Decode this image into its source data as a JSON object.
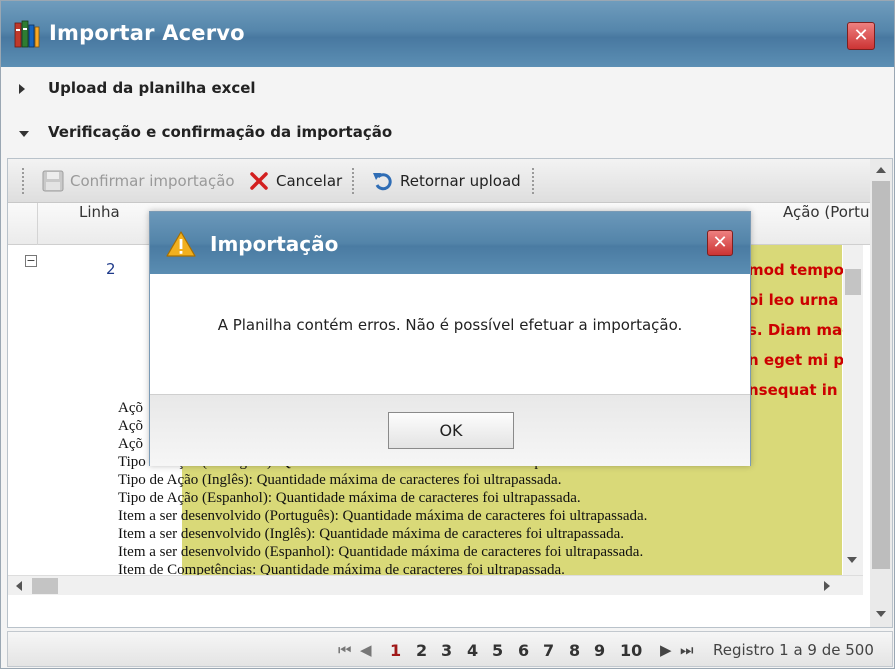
{
  "window": {
    "title": "Importar Acervo"
  },
  "accordion": [
    {
      "label": "Upload da planilha excel",
      "expanded": false
    },
    {
      "label": "Verificação e confirmação da importação",
      "expanded": true
    }
  ],
  "toolbar": {
    "confirm_label": "Confirmar importação",
    "cancel_label": "Cancelar",
    "return_label": "Retornar upload"
  },
  "grid": {
    "columns": {
      "linha": "Linha",
      "acao": "Ação (Portu"
    },
    "row": {
      "number": "2",
      "red_texts": [
        "mod tempo",
        "oi leo urna",
        "s. Diam mad",
        "n eget mi p",
        "nsequat in"
      ],
      "errors": [
        "Açõ",
        "Açõ",
        "Açõ",
        "Tipo de Ação (Português): Quantidade máxima de caracteres foi ultrapassada.",
        "Tipo de Ação (Inglês): Quantidade máxima de caracteres foi ultrapassada.",
        "Tipo de Ação (Espanhol): Quantidade máxima de caracteres foi ultrapassada.",
        "Item a ser desenvolvido (Português): Quantidade máxima de caracteres foi ultrapassada.",
        "Item a ser desenvolvido (Inglês): Quantidade máxima de caracteres foi ultrapassada.",
        "Item a ser desenvolvido (Espanhol): Quantidade máxima de caracteres foi ultrapassada.",
        "Item de Competências: Quantidade máxima de caracteres foi ultrapassada."
      ]
    }
  },
  "pager": {
    "pages": [
      "1",
      "2",
      "3",
      "4",
      "5",
      "6",
      "7",
      "8",
      "9",
      "10"
    ],
    "current": "1",
    "info": "Registro 1 a 9 de 500"
  },
  "dialog": {
    "title": "Importação",
    "message": "A Planilha contém erros. Não é possível efetuar a importação.",
    "ok_label": "OK"
  },
  "colors": {
    "title_bar": "#5586ab",
    "error_text": "#cc0000",
    "highlight": "#d9d978",
    "current_page": "#a01818"
  }
}
